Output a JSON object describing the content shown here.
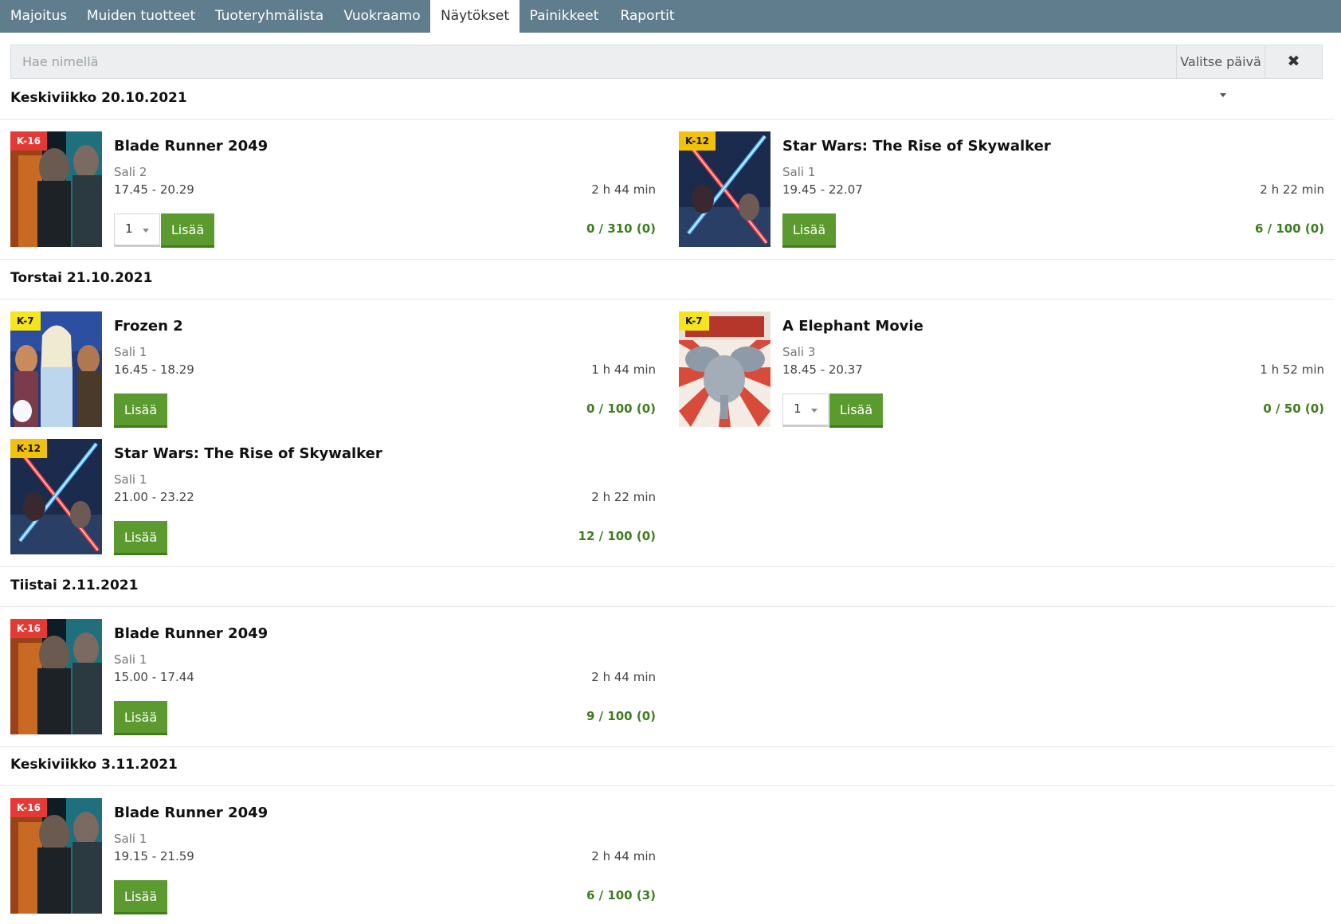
{
  "nav": {
    "tabs": [
      {
        "label": "Majoitus",
        "active": false
      },
      {
        "label": "Muiden tuotteet",
        "active": false
      },
      {
        "label": "Tuoteryhmälista",
        "active": false
      },
      {
        "label": "Vuokraamo",
        "active": false
      },
      {
        "label": "Näytökset",
        "active": true
      },
      {
        "label": "Painikkeet",
        "active": false
      },
      {
        "label": "Raportit",
        "active": false
      }
    ]
  },
  "search": {
    "placeholder": "Hae nimellä",
    "value": "",
    "date_button": "Valitse päivä",
    "clear_icon": "✖"
  },
  "add_label": "Lisää",
  "days": [
    {
      "date": "Keskiviikko 20.10.2021",
      "shows": [
        {
          "title": "Blade Runner 2049",
          "rating": "K-16",
          "hall": "Sali 2",
          "time": "17.45 - 20.29",
          "duration": "2 h 44 min",
          "seats": "0 / 310 (0)",
          "qty": "1",
          "poster": "blade-runner"
        },
        {
          "title": "Star Wars: The Rise of Skywalker",
          "rating": "K-12",
          "hall": "Sali 1",
          "time": "19.45 - 22.07",
          "duration": "2 h 22 min",
          "seats": "6 / 100 (0)",
          "qty": null,
          "poster": "star-wars"
        }
      ]
    },
    {
      "date": "Torstai 21.10.2021",
      "shows": [
        {
          "title": "Frozen 2",
          "rating": "K-7",
          "hall": "Sali 1",
          "time": "16.45 - 18.29",
          "duration": "1 h 44 min",
          "seats": "0 / 100 (0)",
          "qty": null,
          "poster": "frozen"
        },
        {
          "title": "A Elephant Movie",
          "rating": "K-7",
          "hall": "Sali 3",
          "time": "18.45 - 20.37",
          "duration": "1 h 52 min",
          "seats": "0 / 50 (0)",
          "qty": "1",
          "poster": "elephant"
        },
        {
          "title": "Star Wars: The Rise of Skywalker",
          "rating": "K-12",
          "hall": "Sali 1",
          "time": "21.00 - 23.22",
          "duration": "2 h 22 min",
          "seats": "12 / 100 (0)",
          "qty": null,
          "poster": "star-wars"
        }
      ]
    },
    {
      "date": "Tiistai 2.11.2021",
      "shows": [
        {
          "title": "Blade Runner 2049",
          "rating": "K-16",
          "hall": "Sali 1",
          "time": "15.00 - 17.44",
          "duration": "2 h 44 min",
          "seats": "9 / 100 (0)",
          "qty": null,
          "poster": "blade-runner"
        }
      ]
    },
    {
      "date": "Keskiviikko 3.11.2021",
      "shows": [
        {
          "title": "Blade Runner 2049",
          "rating": "K-16",
          "hall": "Sali 1",
          "time": "19.15 - 21.59",
          "duration": "2 h 44 min",
          "seats": "6 / 100 (3)",
          "qty": null,
          "poster": "blade-runner"
        }
      ]
    }
  ]
}
